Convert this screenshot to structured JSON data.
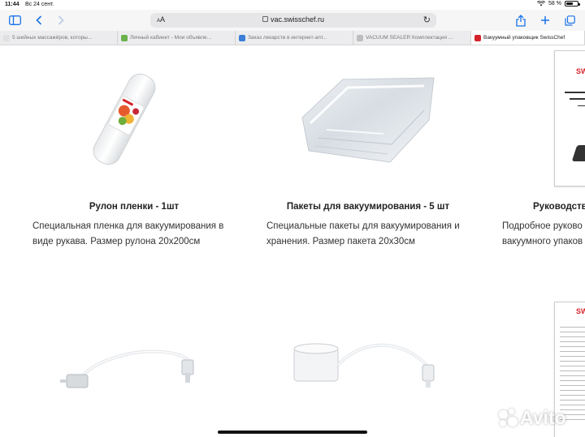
{
  "status_bar": {
    "time": "11:44",
    "date": "Вс 24 сент.",
    "battery": "58 %",
    "battery_level": 0.58
  },
  "browser": {
    "text_size_label": "AA",
    "url": "vac.swisschef.ru",
    "tabs": [
      {
        "label": "5 шейных массажёров, которы...",
        "favicon_color": "#e0e0e0"
      },
      {
        "label": "Личный кабинет - Мои объявле...",
        "favicon_color": "#6ab04c"
      },
      {
        "label": "Заказ лекарств в интернет-апт...",
        "favicon_color": "#3b7dd8"
      },
      {
        "label": "VACUUM SEALER Комплектация ...",
        "favicon_color": "#bdbdbd"
      },
      {
        "label": "Вакуумный упаковщик SwissChef",
        "favicon_color": "#d4232a",
        "active": true
      }
    ]
  },
  "products": [
    {
      "title": "Рулон пленки - 1шт",
      "description": "Специальная пленка для вакуумирования в виде рукава. Размер рулона 20х200см"
    },
    {
      "title": "Пакеты для вакуумирования - 5 шт",
      "description": "Специальные пакеты для вакуумирования и хранения. Размер пакета 20х30см"
    },
    {
      "title": "Руководство",
      "description": "Подробное руково вакуумного упаков"
    }
  ],
  "documents": {
    "brand": "SWIS"
  },
  "watermark": {
    "text": "Avito"
  },
  "colors": {
    "accent": "#1a73e8",
    "brand": "#d4232a"
  }
}
